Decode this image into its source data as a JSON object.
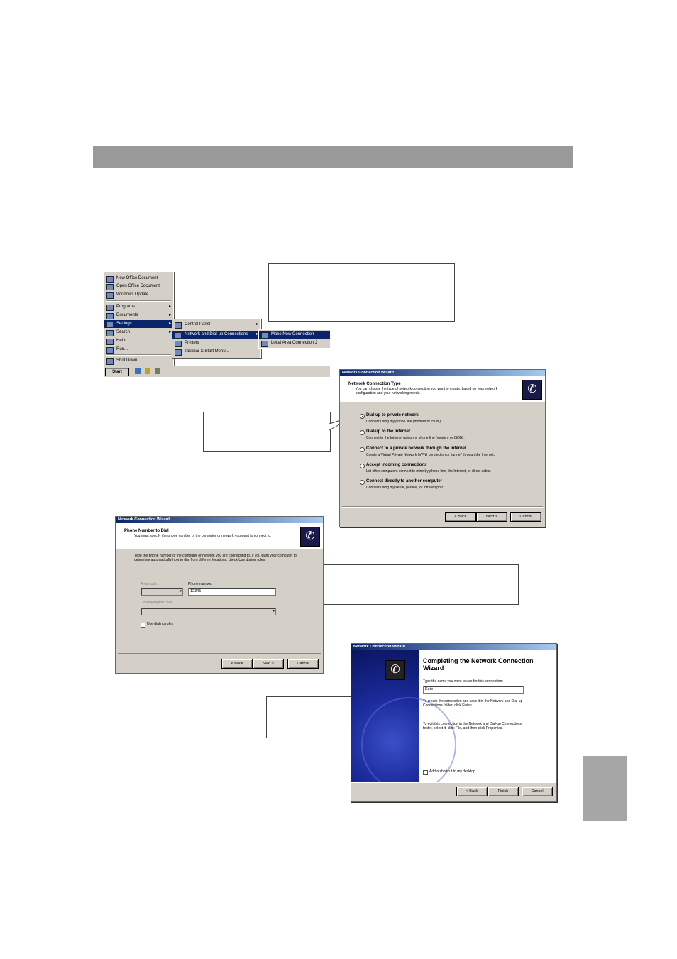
{
  "start_menu": {
    "main_items": [
      "New Office Document",
      "Open Office Document",
      "Windows Update",
      "Programs",
      "Documents",
      "Settings",
      "Search",
      "Help",
      "Run...",
      "Shut Down..."
    ],
    "settings_items": [
      "Control Panel",
      "Network and Dial-up Connections",
      "Printers",
      "Taskbar & Start Menu..."
    ],
    "network_items": [
      "Make New Connection",
      "Local Area Connection 2"
    ],
    "start_label": "Start"
  },
  "wizard1": {
    "title": "Network Connection Wizard",
    "heading": "Network Connection Type",
    "subheading": "You can choose the type of network connection you want to create, based on your network configuration and your networking needs.",
    "options": [
      {
        "label": "Dial-up to private network",
        "desc": "Connect using my phone line (modem or ISDN)."
      },
      {
        "label": "Dial-up to the Internet",
        "desc": "Connect to the Internet using my phone line (modem or ISDN)."
      },
      {
        "label": "Connect to a private network through the Internet",
        "desc": "Create a Virtual Private Network (VPN) connection or 'tunnel' through the Internet."
      },
      {
        "label": "Accept incoming connections",
        "desc": "Let other computers connect to mine by phone line, the Internet, or direct cable."
      },
      {
        "label": "Connect directly to another computer",
        "desc": "Connect using my serial, parallel, or infrared port."
      }
    ],
    "back": "< Back",
    "next": "Next >",
    "cancel": "Cancel"
  },
  "wizard2": {
    "title": "Network Connection Wizard",
    "heading": "Phone Number to Dial",
    "subheading": "You must specify the phone number of the computer or network you want to connect to.",
    "body": "Type the phone number of the computer or network you are connecting to. If you want your computer to determine automatically how to dial from different locations, check Use dialing rules.",
    "area_code_label": "Area code:",
    "phone_label": "Phone number:",
    "phone_value": "12345",
    "country_label": "Country/region code:",
    "use_dialing_rules": "Use dialing rules",
    "back": "< Back",
    "next": "Next >",
    "cancel": "Cancel"
  },
  "wizard3": {
    "title": "Network Connection Wizard",
    "heading": "Completing the Network Connection Wizard",
    "name_prompt": "Type the name you want to use for this connection:",
    "name_value": "Keio",
    "info1": "To create the connection and save it in the Network and Dial-up Connections folder, click Finish.",
    "info2": "To edit this connection in the Network and Dial-up Connections folder, select it, click File, and then click Properties.",
    "shortcut_label": "Add a shortcut to my desktop",
    "back": "< Back",
    "finish": "Finish",
    "cancel": "Cancel"
  }
}
